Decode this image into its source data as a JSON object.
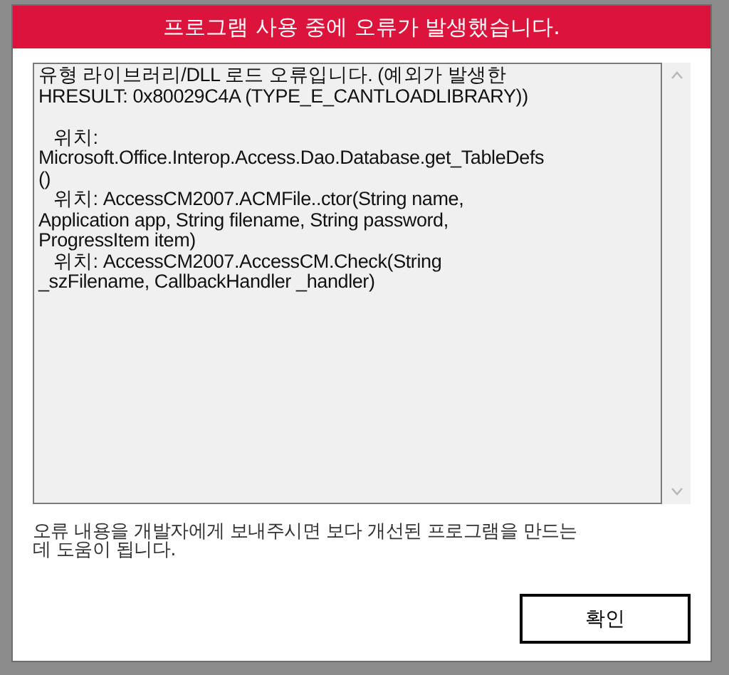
{
  "dialog": {
    "title": "프로그램 사용 중에 오류가 발생했습니다.",
    "details": "유형 라이브러리/DLL 로드 오류입니다. (예외가 발생한\nHRESULT: 0x80029C4A (TYPE_E_CANTLOADLIBRARY))\n\n   위치:\nMicrosoft.Office.Interop.Access.Dao.Database.get_TableDefs\n()\n   위치: AccessCM2007.ACMFile..ctor(String name,\nApplication app, String filename, String password,\nProgressItem item)\n   위치: AccessCM2007.AccessCM.Check(String\n_szFilename, CallbackHandler _handler)",
    "message": "오류 내용을 개발자에게 보내주시면 보다 개선된 프로그램을 만드는\n데 도움이 됩니다.",
    "buttons": [
      "확인"
    ]
  }
}
